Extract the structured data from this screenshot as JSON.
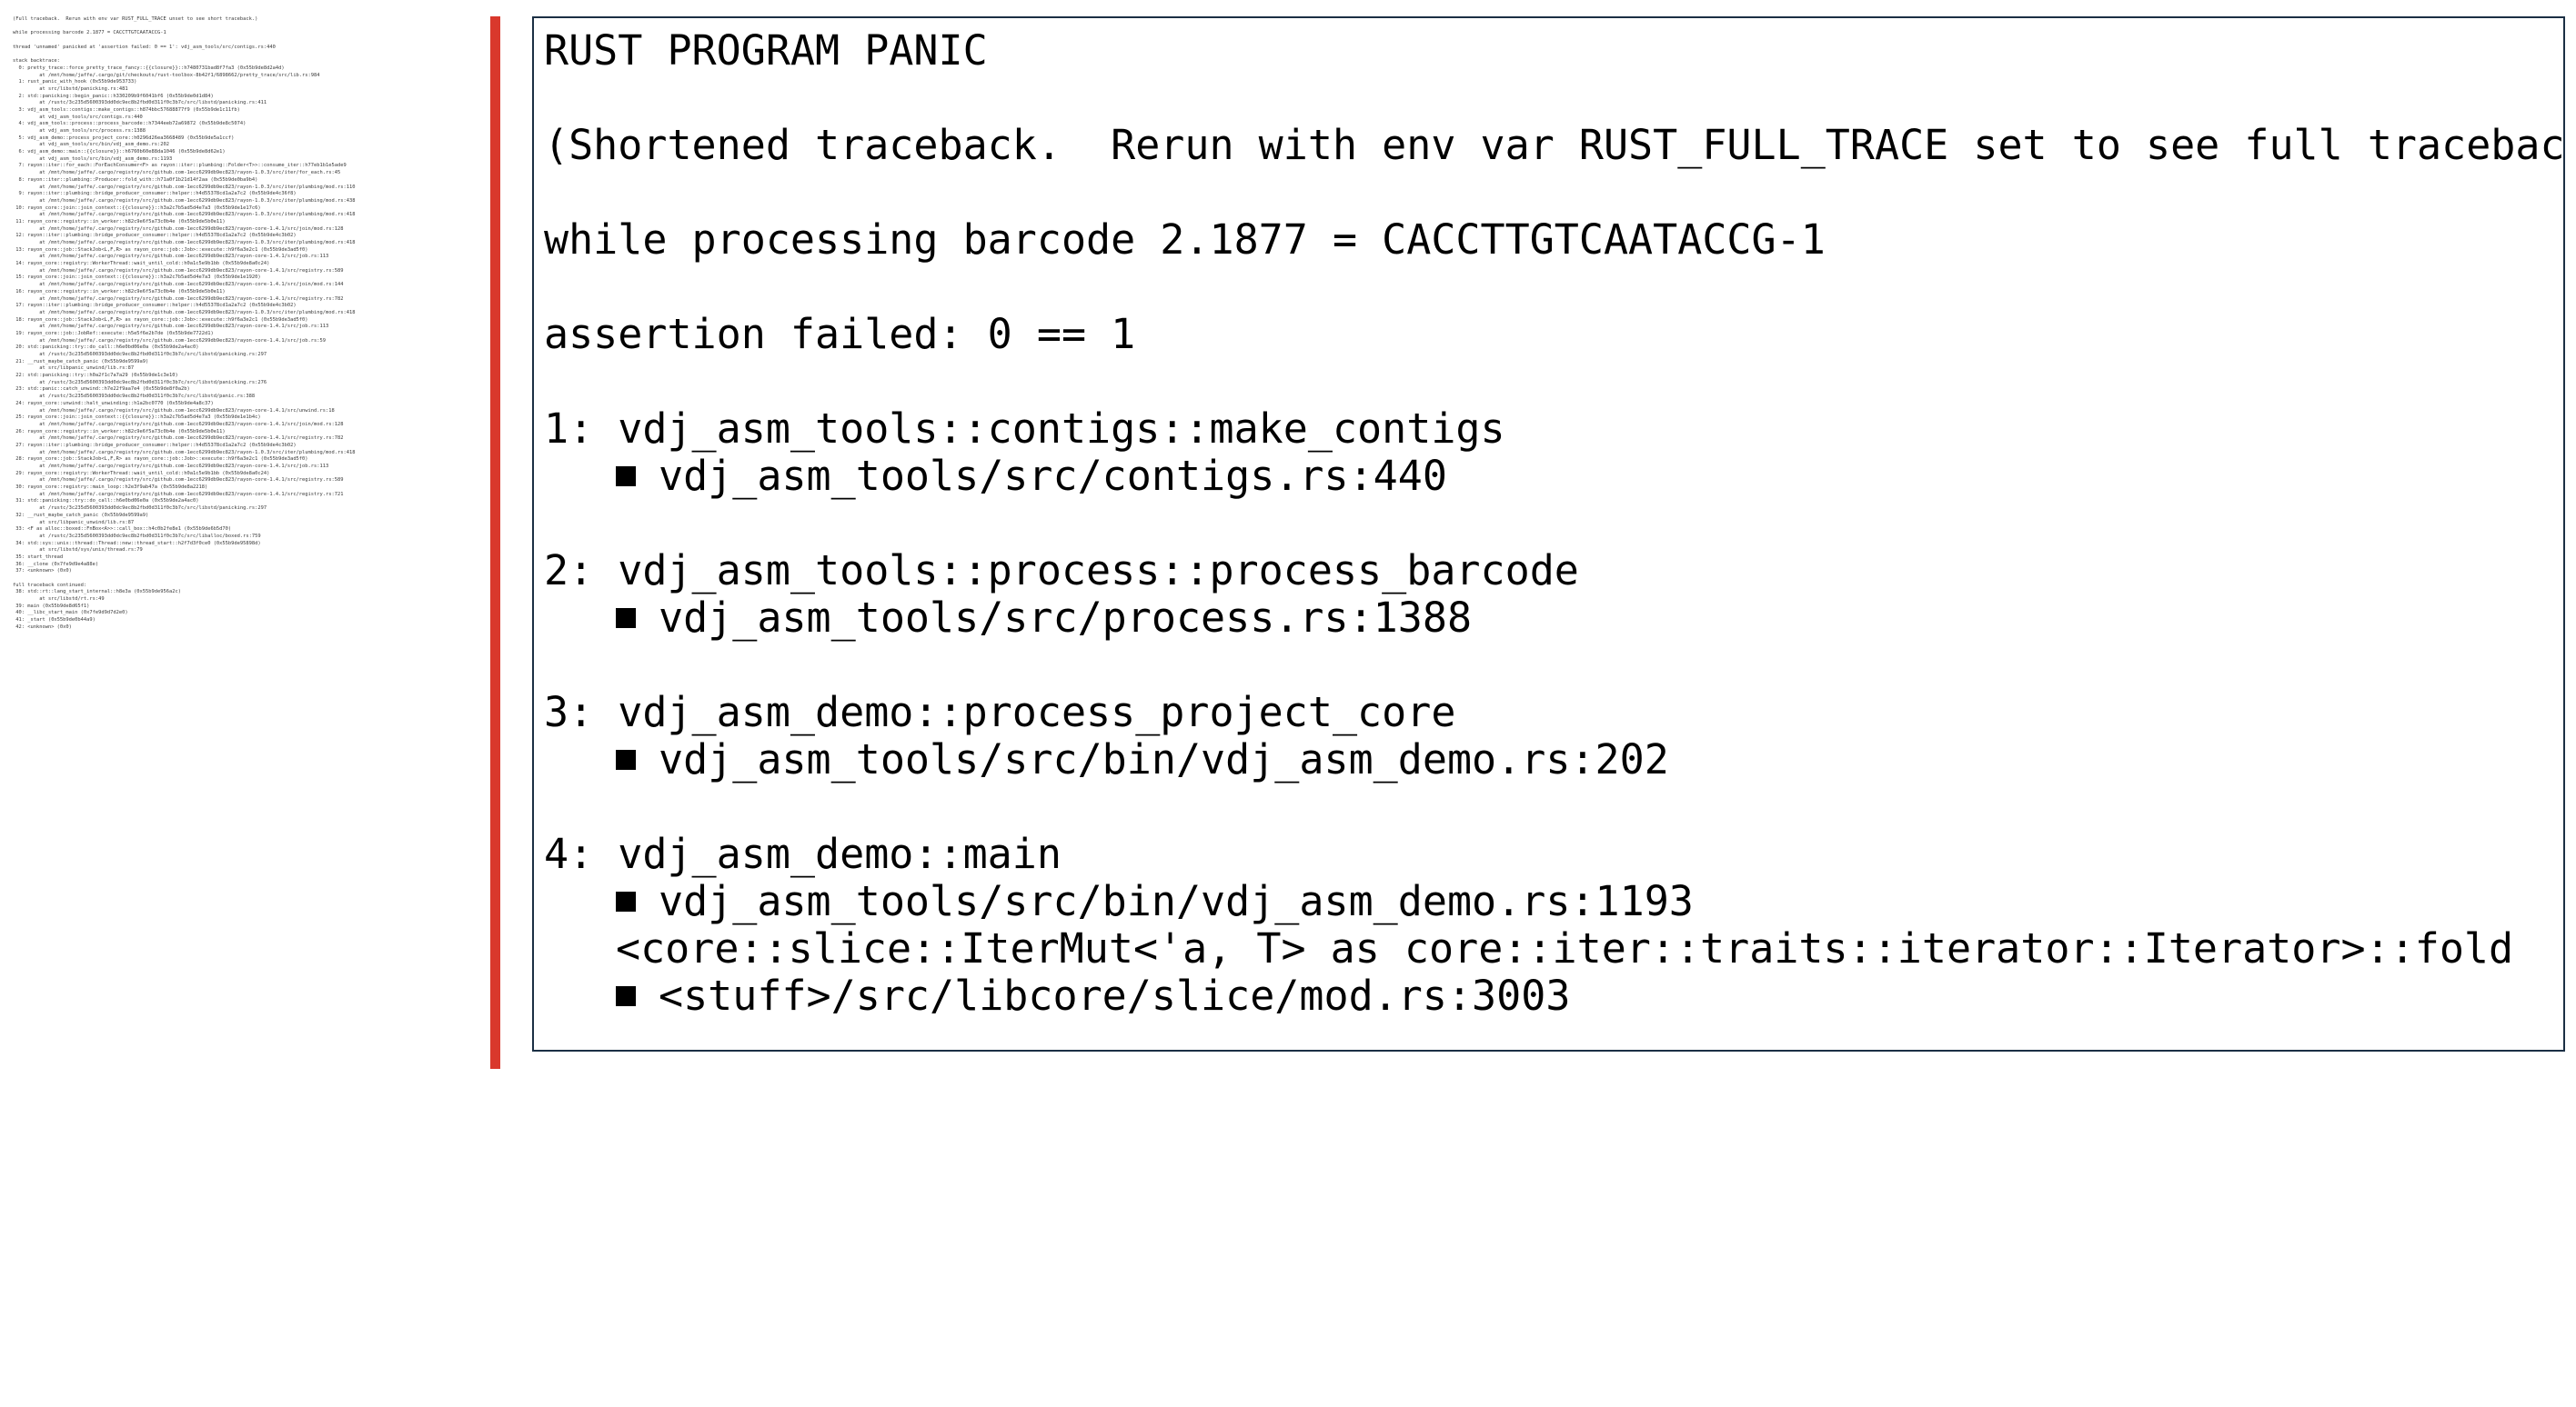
{
  "panic": {
    "title": "RUST PROGRAM PANIC",
    "shortened_note": "(Shortened traceback.  Rerun with env var RUST_FULL_TRACE set to see full traceback.)",
    "barcode_line": "while processing barcode 2.1877 = CACCTTGTCAATACCG-1",
    "assertion_line": "assertion failed: 0 == 1",
    "frames": [
      {
        "label": "1: vdj_asm_tools::contigs::make_contigs",
        "location": "vdj_asm_tools/src/contigs.rs:440"
      },
      {
        "label": "2: vdj_asm_tools::process::process_barcode",
        "location": "vdj_asm_tools/src/process.rs:1388"
      },
      {
        "label": "3: vdj_asm_demo::process_project_core",
        "location": "vdj_asm_tools/src/bin/vdj_asm_demo.rs:202"
      },
      {
        "label": "4: vdj_asm_demo::main",
        "location": "vdj_asm_tools/src/bin/vdj_asm_demo.rs:1193",
        "extra": "<core::slice::IterMut<'a, T> as core::iter::traits::iterator::Iterator>::fold",
        "extra_location": "<stuff>/src/libcore/slice/mod.rs:3003"
      }
    ]
  },
  "full_trace": {
    "lines": [
      "(Full traceback.  Rerun with env var RUST_FULL_TRACE unset to see short traceback.)",
      "",
      "while processing barcode 2.1877 = CACCTTGTCAATACCG-1",
      "",
      "thread 'unnamed' panicked at 'assertion failed: 0 == 1': vdj_asm_tools/src/contigs.rs:440",
      "",
      "stack backtrace:",
      "  0: pretty_trace::force_pretty_trace_fancy::{{closure}}::h7480731bad8f7fa3 (0x55b9de8d2a4d)",
      "         at /mnt/home/jaffe/.cargo/git/checkouts/rust-toolbox-8b42f1/6898662/pretty_trace/src/lib.rs:984",
      "  1: rust_panic_with_hook (0x55b9de953733)",
      "         at src/libstd/panicking.rs:481",
      "  2: std::panicking::begin_panic::h330209b9f6041bf6 (0x55b9de0d1d84)",
      "         at /rustc/3c235d5600393dd0dc9ec8b2fbd0d311f0c3b7c/src/libstd/panicking.rs:411",
      "  3: vdj_asm_tools::contigs::make_contigs::h874bbc57688877f9 (0x55b9de1c11fb)",
      "         at vdj_asm_tools/src/contigs.rs:440",
      "  4: vdj_asm_tools::process::process_barcode::h7344eeb72a69872 (0x55b9de8c5074)",
      "         at vdj_asm_tools/src/process.rs:1388",
      "  5: vdj_asm_demo::process_project_core::h0296d26ea3668489 (0x55b9de5a1ccf)",
      "         at vdj_asm_tools/src/bin/vdj_asm_demo.rs:202",
      "  6: vdj_asm_demo::main::{{closure}}::h6760b60e88da1046 (0x55b9de8d62e1)",
      "         at vdj_asm_tools/src/bin/vdj_asm_demo.rs:1193",
      "  7: rayon::iter::for_each::ForEachConsumer<F> as rayon::iter::plumbing::Folder<T>>::consume_iter::h77eb1b1e5ade9",
      "         at /mnt/home/jaffe/.cargo/registry/src/github.com-1ecc6299db9ec823/rayon-1.0.3/src/iter/for_each.rs:45",
      "  8: rayon::iter::plumbing::Producer::fold_with::h71a0f1b21d14f2aa (0x55b9de0ba9b4)",
      "         at /mnt/home/jaffe/.cargo/registry/src/github.com-1ecc6299db9ec823/rayon-1.0.3/src/iter/plumbing/mod.rs:110",
      "  9: rayon::iter::plumbing::bridge_producer_consumer::helper::h4d55378cd1a2a7c2 (0x55b9de4c36f8)",
      "         at /mnt/home/jaffe/.cargo/registry/src/github.com-1ecc6299db9ec823/rayon-1.0.3/src/iter/plumbing/mod.rs:438",
      " 10: rayon_core::join::join_context::{{closure}}::h3a2c7b5ad5d4e7a3 (0x55b9de1e17c6)",
      "         at /mnt/home/jaffe/.cargo/registry/src/github.com-1ecc6299db9ec823/rayon-1.0.3/src/iter/plumbing/mod.rs:418",
      " 11: rayon_core::registry::in_worker::h82c9e6f5a73c0b4e (0x55b9de5b0e11)",
      "         at /mnt/home/jaffe/.cargo/registry/src/github.com-1ecc6299db9ec823/rayon-core-1.4.1/src/join/mod.rs:128",
      " 12: rayon::iter::plumbing::bridge_producer_consumer::helper::h4d55378cd1a2a7c2 (0x55b9de4c3b02)",
      "         at /mnt/home/jaffe/.cargo/registry/src/github.com-1ecc6299db9ec823/rayon-1.0.3/src/iter/plumbing/mod.rs:418",
      " 13: rayon_core::job::StackJob<L,F,R> as rayon_core::job::Job>::execute::h9f6a3e2c1 (0x55b9de3ad5f0)",
      "         at /mnt/home/jaffe/.cargo/registry/src/github.com-1ecc6299db9ec823/rayon-core-1.4.1/src/job.rs:113",
      " 14: rayon_core::registry::WorkerThread::wait_until_cold::h0a1c5e9b1bb (0x55b9de8a0c24)",
      "         at /mnt/home/jaffe/.cargo/registry/src/github.com-1ecc6299db9ec823/rayon-core-1.4.1/src/registry.rs:589",
      " 15: rayon_core::join::join_context::{{closure}}::h3a2c7b5ad5d4e7a3 (0x55b9de1e1920)",
      "         at /mnt/home/jaffe/.cargo/registry/src/github.com-1ecc6299db9ec823/rayon-core-1.4.1/src/join/mod.rs:144",
      " 16: rayon_core::registry::in_worker::h82c9e6f5a73c0b4e (0x55b9de5b0e11)",
      "         at /mnt/home/jaffe/.cargo/registry/src/github.com-1ecc6299db9ec823/rayon-core-1.4.1/src/registry.rs:782",
      " 17: rayon::iter::plumbing::bridge_producer_consumer::helper::h4d55378cd1a2a7c2 (0x55b9de4c3b02)",
      "         at /mnt/home/jaffe/.cargo/registry/src/github.com-1ecc6299db9ec823/rayon-1.0.3/src/iter/plumbing/mod.rs:418",
      " 18: rayon_core::job::StackJob<L,F,R> as rayon_core::job::Job>::execute::h9f6a3e2c1 (0x55b9de3ad5f0)",
      "         at /mnt/home/jaffe/.cargo/registry/src/github.com-1ecc6299db9ec823/rayon-core-1.4.1/src/job.rs:113",
      " 19: rayon_core::job::JobRef::execute::h5e5f6e2b7de (0x55b9de7722d1)",
      "         at /mnt/home/jaffe/.cargo/registry/src/github.com-1ecc6299db9ec823/rayon-core-1.4.1/src/job.rs:59",
      " 20: std::panicking::try::do_call::h6e0bd06e0a (0x55b9de2a4ac0)",
      "         at /rustc/3c235d5600393dd0dc9ec8b2fbd0d311f0c3b7c/src/libstd/panicking.rs:297",
      " 21: __rust_maybe_catch_panic (0x55b9de9599a9)",
      "         at src/libpanic_unwind/lib.rs:87",
      " 22: std::panicking::try::h0a2f1c7a7a29 (0x55b9de1c3e10)",
      "         at /rustc/3c235d5600393dd0dc9ec8b2fbd0d311f0c3b7c/src/libstd/panicking.rs:276",
      " 23: std::panic::catch_unwind::h7e22f9aa7e4 (0x55b9de8f0a2b)",
      "         at /rustc/3c235d5600393dd0dc9ec8b2fbd0d311f0c3b7c/src/libstd/panic.rs:388",
      " 24: rayon_core::unwind::halt_unwinding::h1a2bc0770 (0x55b9de4a8c37)",
      "         at /mnt/home/jaffe/.cargo/registry/src/github.com-1ecc6299db9ec823/rayon-core-1.4.1/src/unwind.rs:18",
      " 25: rayon_core::join::join_context::{{closure}}::h3a2c7b5ad5d4e7a3 (0x55b9de1e1b4c)",
      "         at /mnt/home/jaffe/.cargo/registry/src/github.com-1ecc6299db9ec823/rayon-core-1.4.1/src/join/mod.rs:128",
      " 26: rayon_core::registry::in_worker::h82c9e6f5a73c0b4e (0x55b9de5b0e11)",
      "         at /mnt/home/jaffe/.cargo/registry/src/github.com-1ecc6299db9ec823/rayon-core-1.4.1/src/registry.rs:782",
      " 27: rayon::iter::plumbing::bridge_producer_consumer::helper::h4d55378cd1a2a7c2 (0x55b9de4c3b02)",
      "         at /mnt/home/jaffe/.cargo/registry/src/github.com-1ecc6299db9ec823/rayon-1.0.3/src/iter/plumbing/mod.rs:418",
      " 28: rayon_core::job::StackJob<L,F,R> as rayon_core::job::Job>::execute::h9f6a3e2c1 (0x55b9de3ad5f0)",
      "         at /mnt/home/jaffe/.cargo/registry/src/github.com-1ecc6299db9ec823/rayon-core-1.4.1/src/job.rs:113",
      " 29: rayon_core::registry::WorkerThread::wait_until_cold::h0a1c5e9b1bb (0x55b9de8a0c24)",
      "         at /mnt/home/jaffe/.cargo/registry/src/github.com-1ecc6299db9ec823/rayon-core-1.4.1/src/registry.rs:589",
      " 30: rayon_core::registry::main_loop::h2e3f9ab47a (0x55b9de8a2218)",
      "         at /mnt/home/jaffe/.cargo/registry/src/github.com-1ecc6299db9ec823/rayon-core-1.4.1/src/registry.rs:721",
      " 31: std::panicking::try::do_call::h6e0bd06e0a (0x55b9de2a4ac0)",
      "         at /rustc/3c235d5600393dd0dc9ec8b2fbd0d311f0c3b7c/src/libstd/panicking.rs:297",
      " 32: __rust_maybe_catch_panic (0x55b9de9599a9)",
      "         at src/libpanic_unwind/lib.rs:87",
      " 33: <F as alloc::boxed::FnBox<A>>::call_box::h4c0b2fe8e1 (0x55b9de6b5d70)",
      "         at /rustc/3c235d5600393dd0dc9ec8b2fbd0d311f0c3b7c/src/liballoc/boxed.rs:759",
      " 34: std::sys::unix::thread::Thread::new::thread_start::h2f7d3f0ce0 (0x55b9de95898d)",
      "         at src/libstd/sys/unix/thread.rs:79",
      " 35: start_thread",
      " 36: __clone (0x7fe9d9e4a88e)",
      " 37: <unknown> (0x0)",
      "",
      "full traceback continued:",
      " 38: std::rt::lang_start_internal::h8e3a (0x55b9de956a2c)",
      "         at src/libstd/rt.rs:49",
      " 39: main (0x55b9de8d65f1)",
      " 40: __libc_start_main (0x7fe9d9d7d2e0)",
      " 41: _start (0x55b9de0b44a9)",
      " 42: <unknown> (0x0)"
    ]
  },
  "colors": {
    "divider": "#d9382c",
    "box_border": "#1b2f44",
    "text": "#000000"
  }
}
